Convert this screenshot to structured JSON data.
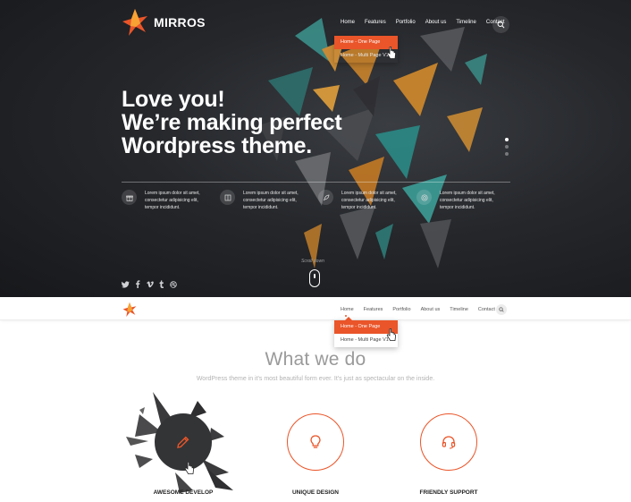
{
  "brand": {
    "name": "MIRROS",
    "accent": "#ea5529"
  },
  "nav": {
    "items": [
      "Home",
      "Features",
      "Portfolio",
      "About us",
      "Timeline",
      "Contact"
    ]
  },
  "dropdown": {
    "items": [
      "Home - One Page",
      "Home - Multi Page V1"
    ]
  },
  "hero": {
    "headline": [
      "Love you!",
      "We’re making perfect",
      "Wordpress theme."
    ],
    "features": [
      {
        "icon": "gift-icon",
        "text": [
          "Lorem ipsum dolor sit amet,",
          "consectetur adipisicing elit,",
          "tempor incididunt."
        ]
      },
      {
        "icon": "book-icon",
        "text": [
          "Lorem ipsum dolor sit amet,",
          "consectetur adipisicing elit,",
          "tempor incididunt."
        ]
      },
      {
        "icon": "rocket-icon",
        "text": [
          "Lorem ipsum dolor sit amet,",
          "consectetur adipisicing elit,",
          "tempor incididunt."
        ]
      },
      {
        "icon": "lifebuoy-icon",
        "text": [
          "Lorem ipsum dolor sit amet,",
          "consectetur adipisicing elit,",
          "tempor incididunt."
        ]
      }
    ],
    "scroll_label": "Scroll down",
    "social": [
      "twitter-icon",
      "facebook-icon",
      "vimeo-icon",
      "tumblr-icon",
      "dribbble-icon"
    ]
  },
  "section": {
    "title": "What we do",
    "subtitle": "WordPress theme in it's most beautiful form ever. It's just as spectacular on the inside.",
    "services": [
      {
        "label": "AWESOME DEVELOP",
        "icon": "pencil-icon"
      },
      {
        "label": "UNIQUE DESIGN",
        "icon": "lightbulb-icon"
      },
      {
        "label": "FRIENDLY SUPPORT",
        "icon": "headset-icon"
      }
    ]
  }
}
